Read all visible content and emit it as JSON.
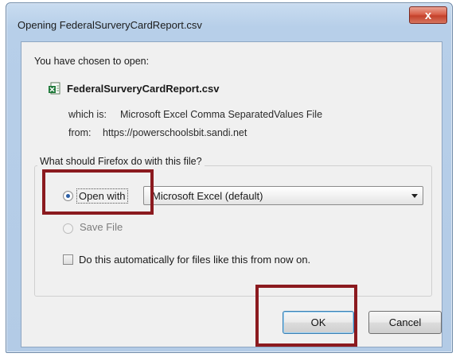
{
  "window": {
    "title": "Opening FederalSurveryCardReport.csv",
    "close_symbol": "x"
  },
  "dialog": {
    "intro": "You have chosen to open:",
    "file_name": "FederalSurveryCardReport.csv",
    "which_is_label": "which is:",
    "which_is_value": "Microsoft Excel Comma SeparatedValues File",
    "from_label": "from:",
    "from_value": "https://powerschoolsbit.sandi.net"
  },
  "action_group": {
    "title": "What should Firefox do with this file?",
    "open_with": {
      "label": "Open with",
      "selected": true
    },
    "app_select": {
      "value": "Microsoft Excel (default)"
    },
    "save_file": {
      "label": "Save File",
      "selected": false
    },
    "auto_checkbox": {
      "label": "Do this automatically for files like this from now on.",
      "checked": false
    }
  },
  "buttons": {
    "ok": "OK",
    "cancel": "Cancel"
  },
  "colors": {
    "highlight": "#8b1a1f",
    "titlebar": "#b7cfe9",
    "close_button": "#c4412b"
  },
  "icons": {
    "file": "csv-file-icon",
    "close": "close-icon",
    "dropdown": "chevron-down-icon"
  }
}
